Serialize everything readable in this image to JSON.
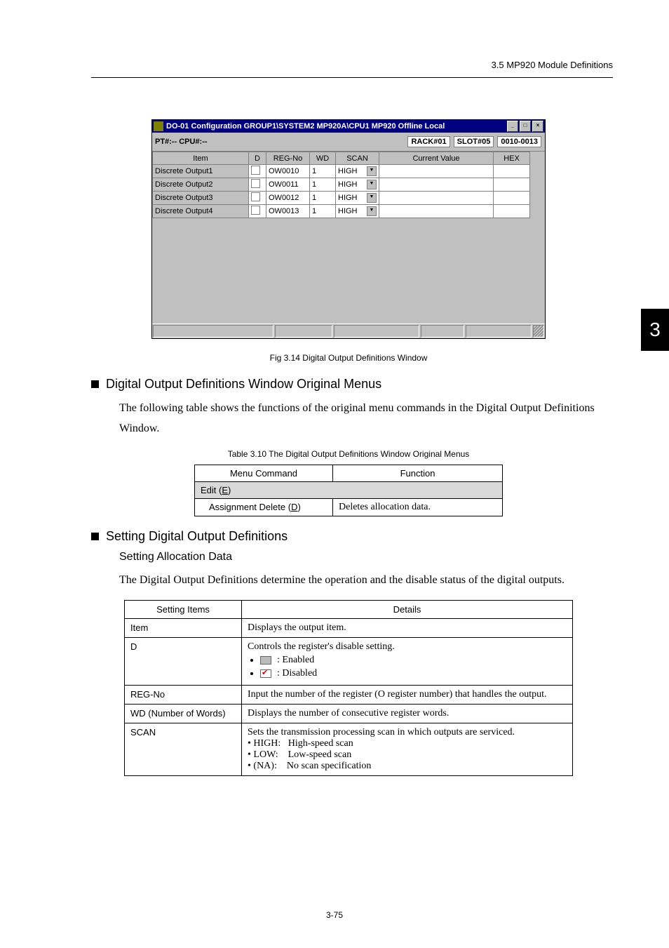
{
  "header": {
    "section": "3.5 MP920 Module Definitions"
  },
  "side_tab": "3",
  "window": {
    "title": "DO-01 Configuration     GROUP1\\SYSTEM2  MP920A\\CPU1  MP920       Offline  Local",
    "controls": {
      "min": "_",
      "max": "□",
      "close": "×"
    },
    "row2": {
      "pt": "PT#:--  CPU#:--",
      "rack": "RACK#01",
      "slot": "SLOT#05",
      "range": "0010-0013"
    },
    "columns": [
      "Item",
      "D",
      "REG-No",
      "WD",
      "SCAN",
      "Current Value",
      "HEX"
    ],
    "rows": [
      {
        "item": "Discrete Output1",
        "reg": "OW0010",
        "wd": "1",
        "scan": "HIGH"
      },
      {
        "item": "Discrete Output2",
        "reg": "OW0011",
        "wd": "1",
        "scan": "HIGH"
      },
      {
        "item": "Discrete Output3",
        "reg": "OW0012",
        "wd": "1",
        "scan": "HIGH"
      },
      {
        "item": "Discrete Output4",
        "reg": "OW0013",
        "wd": "1",
        "scan": "HIGH"
      }
    ]
  },
  "fig_caption": "Fig 3.14  Digital Output Definitions Window",
  "h2a": "Digital Output Definitions Window Original Menus",
  "para_a": "The following table shows the functions of the original menu commands in the Digital Output Definitions Window.",
  "table_caption": "Table 3.10  The Digital Output Definitions Window Original Menus",
  "menu_table": {
    "head": [
      "Menu Command",
      "Function"
    ],
    "edit_row": {
      "label_pre": "Edit (",
      "key": "E",
      "label_post": ")"
    },
    "assign_row": {
      "label_pre": "Assignment Delete (",
      "key": "D",
      "label_post": ")",
      "func": "Deletes allocation data."
    }
  },
  "h2b": "Setting Digital Output Definitions",
  "h3": "Setting Allocation Data",
  "para_b": "The Digital Output Definitions determine the operation and the disable status of the digital outputs.",
  "details": {
    "head": [
      "Setting Items",
      "Details"
    ],
    "rows": {
      "item": {
        "name": "Item",
        "text": "Displays the output item."
      },
      "d": {
        "name": "D",
        "text": "Controls the register's disable setting.",
        "enabled": ": Enabled",
        "disabled": ": Disabled"
      },
      "regno": {
        "name": "REG-No",
        "text": "Input the number of the register (O register number) that handles the output."
      },
      "wd": {
        "name": "WD (Number of Words)",
        "text": "Displays the number of consecutive register words."
      },
      "scan": {
        "name": "SCAN",
        "text": "Sets the transmission processing scan in which outputs are serviced.",
        "b1a": "• HIGH:",
        "b1b": "High-speed scan",
        "b2a": "• LOW:",
        "b2b": "Low-speed scan",
        "b3a": "• (NA):",
        "b3b": "No scan specification"
      }
    }
  },
  "footer": "3-75"
}
